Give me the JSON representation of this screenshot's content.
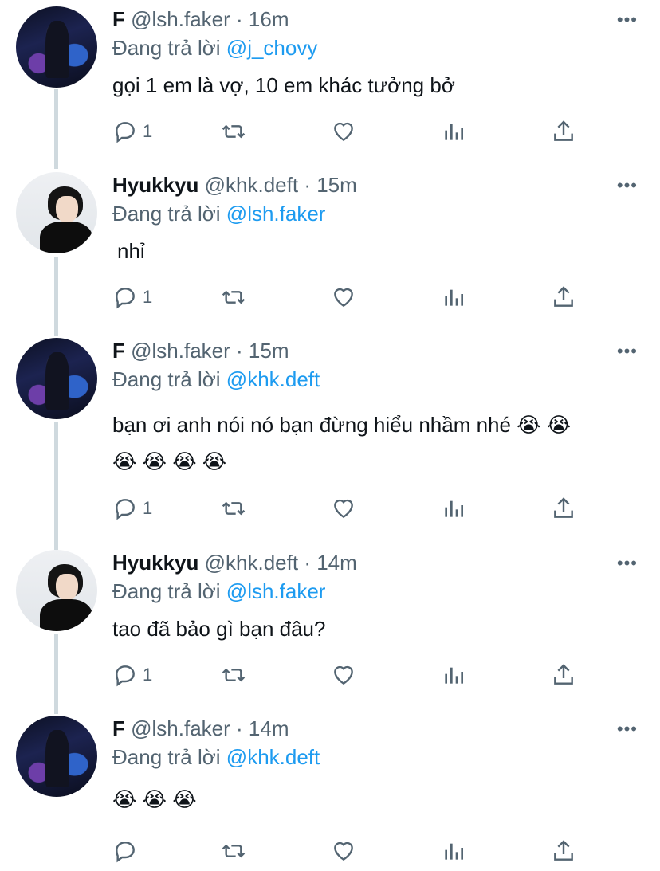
{
  "labels": {
    "replying_to": "Đang trả lời"
  },
  "tweets": [
    {
      "author_name": "F",
      "handle": "@lsh.faker",
      "time": "· 16m",
      "replying_to": "@j_chovy",
      "text": "gọi 1 em là vợ, 10 em khác tưởng bở",
      "reply_count": "1",
      "avatar": "faker-avatar"
    },
    {
      "author_name": "Hyukkyu",
      "handle": "@khk.deft",
      "time": "· 15m",
      "replying_to": "@lsh.faker",
      "text": "nhỉ",
      "reply_count": "1",
      "avatar": "deft-avatar"
    },
    {
      "author_name": "F",
      "handle": "@lsh.faker",
      "time": "· 15m",
      "replying_to": "@khk.deft",
      "text": "bạn ơi anh nói nó bạn đừng hiểu nhầm nhé 😭 😭",
      "text2": "😭 😭 😭 😭",
      "reply_count": "1",
      "avatar": "faker-avatar"
    },
    {
      "author_name": "Hyukkyu",
      "handle": "@khk.deft",
      "time": "· 14m",
      "replying_to": "@lsh.faker",
      "text": "tao đã bảo gì bạn đâu?",
      "reply_count": "1",
      "avatar": "deft-avatar"
    },
    {
      "author_name": "F",
      "handle": "@lsh.faker",
      "time": "· 14m",
      "replying_to": "@khk.deft",
      "text": "😭 😭 😭",
      "reply_count": "",
      "avatar": "faker-avatar"
    }
  ],
  "icons": {
    "reply": "reply-icon",
    "retweet": "retweet-icon",
    "like": "heart-icon",
    "analytics": "analytics-icon",
    "share": "share-icon",
    "more": "more-icon"
  },
  "colors": {
    "link": "#1d9bf0",
    "secondary_text": "#536471",
    "thread_line": "#cfd9de"
  }
}
